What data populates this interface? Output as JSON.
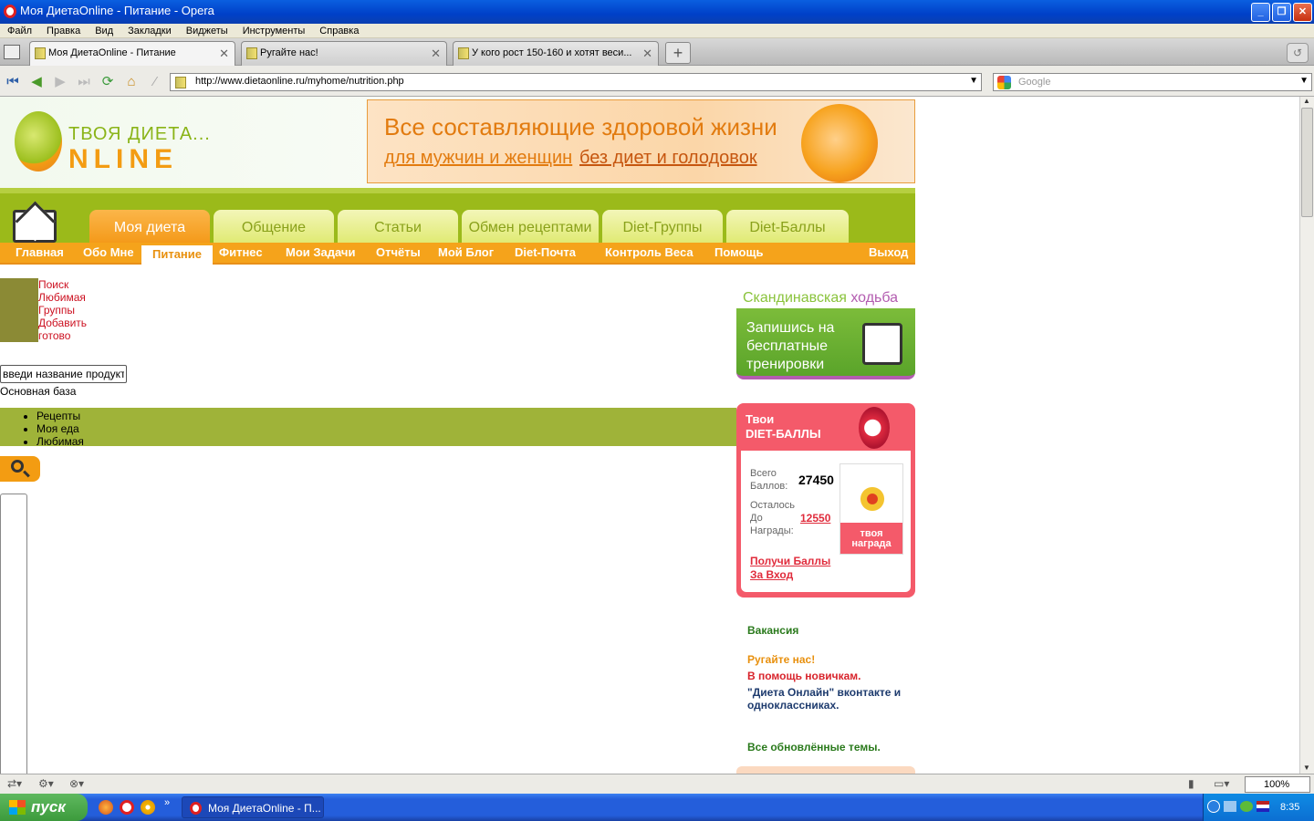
{
  "window": {
    "title": "Моя ДиетаOnline - Питание - Opera"
  },
  "menubar": [
    "Файл",
    "Правка",
    "Вид",
    "Закладки",
    "Виджеты",
    "Инструменты",
    "Справка"
  ],
  "tabs": [
    {
      "label": "Моя ДиетаOnline - Питание",
      "active": true
    },
    {
      "label": "Ругайте нас!",
      "active": false
    },
    {
      "label": "У кого рост 150-160 и хотят веси...",
      "active": false
    }
  ],
  "address": {
    "url": "http://www.dietaonline.ru/myhome/nutrition.php",
    "search_placeholder": "Google"
  },
  "site": {
    "logo_top": "ТВОЯ ДИЕТА...",
    "logo_bottom": "NLINE",
    "banner": {
      "line1": "Все составляющие здоровой жизни",
      "link1": "для мужчин и женщин",
      "link2": "без диет и голодовок"
    },
    "main_tabs": [
      "Моя диета",
      "Общение",
      "Статьи",
      "Обмен рецептами",
      "Diet-Группы",
      "Diet-Баллы"
    ],
    "sub_nav": [
      "Главная",
      "Обо Мне",
      "Питание",
      "Фитнес",
      "Мои Задачи",
      "Отчёты",
      "Мой Блог",
      "Diet-Почта",
      "Контроль Веса",
      "Помощь",
      "Выход"
    ],
    "left_links": [
      "Поиск",
      "Любимая",
      "Группы",
      "Добавить",
      "готово"
    ],
    "product_input": "введи название продукта",
    "base_label": "Основная база",
    "sub_tabs": [
      "Рецепты",
      "Моя еда",
      "Любимая"
    ],
    "nordic": {
      "title_a": "Скандинавская",
      "title_b": "ходьба",
      "l1": "Запишись на",
      "l2": "бесплатные",
      "l3": "тренировки"
    },
    "points": {
      "header1": "Твои",
      "header2": "DIET-БАЛЛЫ",
      "total_l1": "Всего",
      "total_l2": "Баллов:",
      "total_value": "27450",
      "left_l1": "Осталось",
      "left_l2": "До",
      "left_l3": "Награды:",
      "left_value": "12550",
      "award_l1": "твоя",
      "award_l2": "награда",
      "link_l1": "Получи Баллы",
      "link_l2": "За Вход"
    },
    "right_links": [
      {
        "text": "Вакансия",
        "color": "#2a7a1c"
      },
      {
        "text": "Ругайте нас!",
        "color": "#e8900e"
      },
      {
        "text": "В помощь новичкам.",
        "color": "#d8242c"
      },
      {
        "text": "\"Диета Онлайн\" вконтакте и",
        "color": "#1e3b6e"
      },
      {
        "text": "одноклассниках.",
        "color": "#1e3b6e"
      },
      {
        "text": "Все обновлённые темы.",
        "color": "#2a7a1c"
      }
    ]
  },
  "status": {
    "zoom": "100%"
  },
  "taskbar": {
    "start": "пуск",
    "item": "Моя ДиетаOnline - П...",
    "clock": "8:35"
  }
}
